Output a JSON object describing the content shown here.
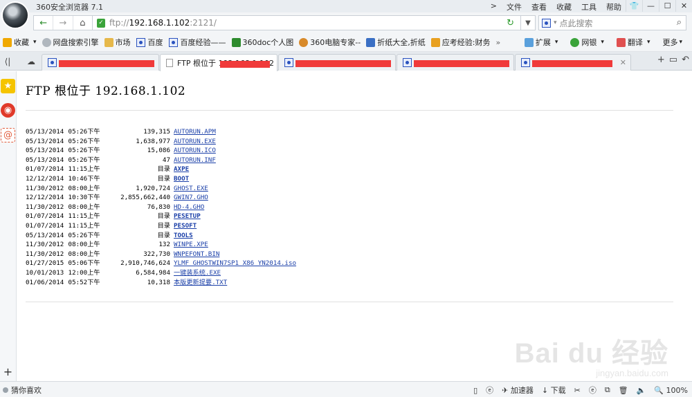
{
  "app": {
    "title": "360安全浏览器 7.1",
    "menu": [
      ">",
      "文件",
      "查看",
      "收藏",
      "工具",
      "帮助"
    ],
    "win_buttons": [
      "shirt-icon",
      "minimize",
      "maximize",
      "close"
    ]
  },
  "address": {
    "url_prefix": "ftp://",
    "url_host": "192.168.1.102",
    "url_suffix": ":2121/",
    "search_placeholder": "点此搜索"
  },
  "bookmarks": {
    "items": [
      {
        "label": "收藏",
        "icon": "star-icon",
        "color": "#f0a800"
      },
      {
        "label": "网盘搜索引擎",
        "icon": "globe-icon",
        "color": "#8a8a8a"
      },
      {
        "label": "市场",
        "icon": "folder-icon",
        "color": "#e6b84a"
      },
      {
        "label": "百度",
        "icon": "baidu-paw-icon",
        "color": "#2a52be"
      },
      {
        "label": "百度经验——",
        "icon": "baidu-paw-icon",
        "color": "#2a52be"
      },
      {
        "label": "360doc个人图",
        "icon": "360doc-icon",
        "color": "#2e8b2e"
      },
      {
        "label": "360电脑专家--",
        "icon": "expert-icon",
        "color": "#d88a2a"
      },
      {
        "label": "折纸大全,折纸",
        "icon": "grid-icon",
        "color": "#3a6fc4"
      },
      {
        "label": "应考经验:财务",
        "icon": "doc-icon",
        "color": "#e8a020"
      }
    ],
    "more": "»",
    "right": [
      {
        "label": "扩展",
        "icon": "puzzle-icon"
      },
      {
        "label": "网银",
        "icon": "shield-icon"
      },
      {
        "label": "翻译",
        "icon": "translate-icon"
      },
      {
        "label": "更多",
        "icon": "more-icon"
      }
    ]
  },
  "tabs": [
    {
      "label": "",
      "icon": "baidu-paw-icon",
      "active": false
    },
    {
      "label": "FTP 根位于 192.168.1.102",
      "icon": "page-icon",
      "active": true
    },
    {
      "label": "",
      "icon": "baidu-paw-icon",
      "active": false
    },
    {
      "label": "",
      "icon": "baidu-paw-icon",
      "active": false
    },
    {
      "label": "",
      "icon": "baidu-paw-icon",
      "active": false
    }
  ],
  "page": {
    "heading": "FTP 根位于 192.168.1.102",
    "dir_label": "目录",
    "entries": [
      {
        "date": "05/13/2014",
        "time": "05:26下午",
        "size": "139,315",
        "name": "AUTORUN.APM",
        "dir": false
      },
      {
        "date": "05/13/2014",
        "time": "05:26下午",
        "size": "1,638,977",
        "name": "AUTORUN.EXE",
        "dir": false
      },
      {
        "date": "05/13/2014",
        "time": "05:26下午",
        "size": "15,086",
        "name": "AUTORUN.ICO",
        "dir": false
      },
      {
        "date": "05/13/2014",
        "time": "05:26下午",
        "size": "47",
        "name": "AUTORUN.INF",
        "dir": false
      },
      {
        "date": "01/07/2014",
        "time": "11:15上午",
        "size": "",
        "name": "AXPE",
        "dir": true
      },
      {
        "date": "12/12/2014",
        "time": "10:46下午",
        "size": "",
        "name": "BOOT",
        "dir": true
      },
      {
        "date": "11/30/2012",
        "time": "08:00上午",
        "size": "1,920,724",
        "name": "GHOST.EXE",
        "dir": false
      },
      {
        "date": "12/12/2014",
        "time": "10:30下午",
        "size": "2,855,662,440",
        "name": "GWIN7.GHO",
        "dir": false
      },
      {
        "date": "11/30/2012",
        "time": "08:00上午",
        "size": "76,830",
        "name": "HD-4.GHO",
        "dir": false
      },
      {
        "date": "01/07/2014",
        "time": "11:15上午",
        "size": "",
        "name": "PESETUP",
        "dir": true
      },
      {
        "date": "01/07/2014",
        "time": "11:15上午",
        "size": "",
        "name": "PESOFT",
        "dir": true
      },
      {
        "date": "05/13/2014",
        "time": "05:26下午",
        "size": "",
        "name": "TOOLS",
        "dir": true
      },
      {
        "date": "11/30/2012",
        "time": "08:00上午",
        "size": "132",
        "name": "WINPE.XPE",
        "dir": false
      },
      {
        "date": "11/30/2012",
        "time": "08:00上午",
        "size": "322,730",
        "name": "WNPEFONT.BIN",
        "dir": false
      },
      {
        "date": "01/27/2015",
        "time": "05:06下午",
        "size": "2,910,746,624",
        "name": "YLMF_GHOSTWIN7SP1_X86_YN2014.iso",
        "dir": false
      },
      {
        "date": "10/01/2013",
        "time": "12:00上午",
        "size": "6,584,984",
        "name": "一键装系统.EXE",
        "dir": false
      },
      {
        "date": "01/06/2014",
        "time": "05:52下午",
        "size": "10,318",
        "name": "本版更新提要.TXT",
        "dir": false
      }
    ]
  },
  "watermark": {
    "big": "Bai du 经验",
    "small": "jingyan.baidu.com"
  },
  "status": {
    "left": "猜你喜欢",
    "accelerator": "加速器",
    "download": "下载",
    "zoom": "100%"
  },
  "colors": {
    "link": "#1a3fa8",
    "redaction": "#f03a3a",
    "accent_green": "#2a8b2a"
  }
}
